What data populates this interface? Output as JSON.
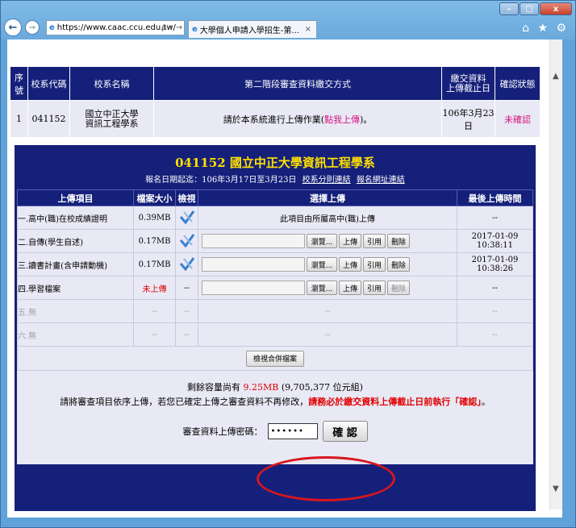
{
  "browser": {
    "address": "https://www.caac.ccu.edu.tw/",
    "address_tools": "ρ ▾ →",
    "tab_title": "大學個人申請入學招生-第...",
    "tab_close": "×",
    "right_icons": "⌂ ★ ⚙"
  },
  "top_table": {
    "headers": [
      "序號",
      "校系代碼",
      "校系名稱",
      "第二階段審查資料繳交方式",
      "繳交資料\n上傳截止日",
      "確認狀態"
    ],
    "row": {
      "index": "1",
      "code": "041152",
      "name": "國立中正大學\n資訊工程學系",
      "method_prefix": "請於本系統進行上傳作業(",
      "method_link": "點我上傳",
      "method_suffix": ")。",
      "deadline": "106年3月23日",
      "status": "未確認"
    }
  },
  "panel": {
    "title": "041152 國立中正大學資訊工程學系",
    "date_text": "報名日期起迄：106年3月17日至3月23日",
    "link_rules": "校系分則連結",
    "link_site": "報名網址連結",
    "headers": [
      "上傳項目",
      "檔案大小",
      "檢視",
      "選擇上傳",
      "最後上傳時間"
    ],
    "rows": [
      {
        "item": "一.高中(職)在校成績證明",
        "size": "0.39MB",
        "view": "check",
        "upload_text": "此項目由所屬高中(職)上傳",
        "time": "--"
      },
      {
        "item": "二.自傳(學生自述)",
        "size": "0.17MB",
        "view": "check",
        "time": "2017-01-09 10:38:11"
      },
      {
        "item": "三.讀書計畫(含申請動機)",
        "size": "0.17MB",
        "view": "check",
        "time": "2017-01-09 10:38:26"
      },
      {
        "item": "四.學習檔案",
        "size": "未上傳",
        "view": "--",
        "time": "--"
      },
      {
        "item": "五.無",
        "size": "--",
        "view": "--",
        "upload_text": "--",
        "time": "--"
      },
      {
        "item": "六.無",
        "size": "--",
        "view": "--",
        "upload_text": "--",
        "time": "--"
      }
    ],
    "btn_browse": "瀏覽...",
    "btn_upload": "上傳",
    "btn_cite": "引用",
    "btn_delete": "刪除",
    "merge_button": "檢視合併檔案",
    "remaining_prefix": "剩餘容量尚有 ",
    "remaining_value": "9.25MB",
    "remaining_suffix": " (9,705,377 位元組)",
    "notice_prefix": "請將審查項目依序上傳，若您已確定上傳之審查資料不再修改，",
    "notice_red": "請務必於繳交資料上傳截止日前執行「確認」",
    "notice_suffix": "。",
    "password_label": "審查資料上傳密碼：",
    "password_value": "••••••",
    "confirm_label": "確 認"
  },
  "colors": {
    "header_bg": "#15207a",
    "row_bg": "#e9e9f5",
    "highlight": "#d8161d",
    "accent_yellow": "#ffe000"
  }
}
